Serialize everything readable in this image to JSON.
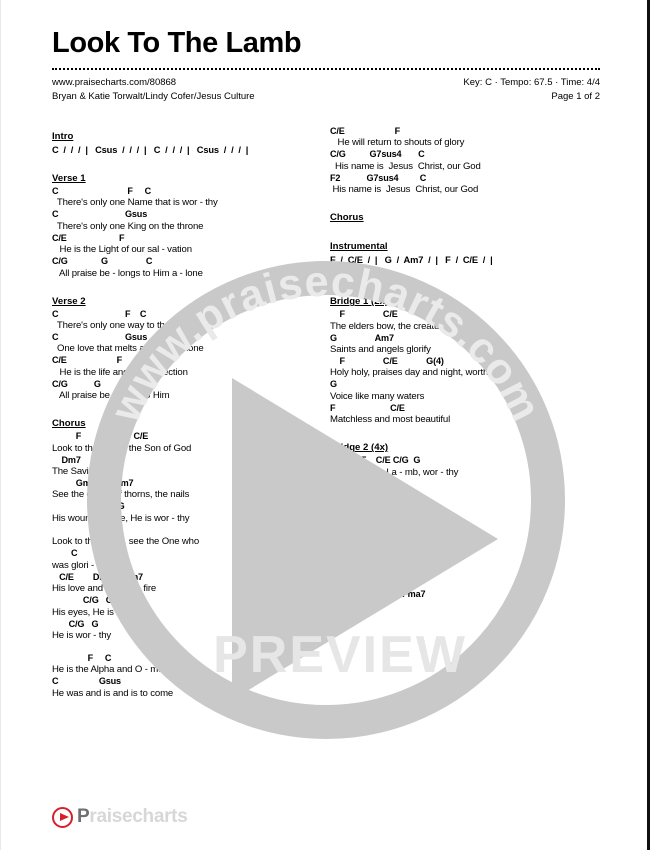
{
  "header": {
    "title": "Look To The Lamb",
    "url": "www.praisecharts.com/80868",
    "authors": "Bryan & Katie Torwalt/Lindy Cofer/Jesus Culture",
    "key_tempo_time": "Key: C · Tempo: 67.5 · Time: 4/4",
    "page_number": "Page 1 of 2"
  },
  "watermark": {
    "ring_text": "www.praisecharts.com",
    "preview_label": "PREVIEW",
    "ring_color": "#c9c9c9",
    "triangle_color": "#c9c9c9",
    "preview_color": "#e2e2e2"
  },
  "brand": {
    "name_visible": "P",
    "name_faded": "raisecharts",
    "accent_color": "#d6212b",
    "text_color": "#6f7072"
  },
  "left_column": [
    {
      "label": "Intro",
      "type": "progression",
      "lines": [
        "C  /  /  /  |   Csus  /  /  /  |   C  /  /  /  |   Csus  /  /  /  |"
      ]
    },
    {
      "label": "Verse 1",
      "type": "chords",
      "lines": [
        {
          "chords": "C                             F     C",
          "lyrics": "  There's only one Name that is wor - thy"
        },
        {
          "chords": "C                            Gsus",
          "lyrics": "  There's only one King on the throne"
        },
        {
          "chords": "C/E                      F",
          "lyrics": "   He is the Light of our sal - vation"
        },
        {
          "chords": "C/G              G                C",
          "lyrics": "   All praise be - longs to Him a - lone"
        }
      ]
    },
    {
      "label": "Verse 2",
      "type": "chords",
      "lines": [
        {
          "chords": "C                            F    C",
          "lyrics": "  There's only one way to the Fa - ther"
        },
        {
          "chords": "C                            Gsus",
          "lyrics": "  One love that melts a heart of stone"
        },
        {
          "chords": "C/E                     F",
          "lyrics": "   He is the life and resur - rection"
        },
        {
          "chords": "C/G           G",
          "lyrics": "   All praise be - longs to Him"
        }
      ]
    },
    {
      "label": "Chorus",
      "type": "chords",
      "lines": [
        {
          "chords": "          F                      C/E",
          "lyrics": "Look to the Lamb, the Son of God"
        },
        {
          "chords": "    Dm7",
          "lyrics": "The Savior"
        },
        {
          "chords": "          Gm7        Am7",
          "lyrics": "See the crown of thorns, the nails"
        },
        {
          "chords": "                  C/G   G",
          "lyrics": "His wounded side, He is wor - thy"
        },
        {
          "chords": "",
          "lyrics": "Look to the Lamb, see the One who"
        },
        {
          "chords": "        C       G",
          "lyrics": "was glori - fied"
        },
        {
          "chords": "   C/E        Dm7     Am7",
          "lyrics": "His love and there is   fire"
        },
        {
          "chords": "             C/G   G   /  C/E",
          "lyrics": "His eyes, He is wor - thy"
        },
        {
          "chords": "       C/G   G",
          "lyrics": "He is wor - thy"
        }
      ]
    },
    {
      "label": "",
      "type": "chords",
      "lines": [
        {
          "chords": "               F     C",
          "lyrics": "He is the Alpha and O - me - ga"
        },
        {
          "chords": "C                 Gsus",
          "lyrics": "He was and is and is to come"
        }
      ]
    }
  ],
  "right_column": [
    {
      "label": "",
      "type": "chords",
      "lines": [
        {
          "chords": "C/E                     F",
          "lyrics": "   He will return to shouts of glory"
        },
        {
          "chords": "C/G          G7sus4       C",
          "lyrics": "  His name is  Jesus  Christ, our God"
        },
        {
          "chords": "F2           G7sus4         C",
          "lyrics": " His name is  Jesus  Christ, our God"
        }
      ]
    },
    {
      "label": "Chorus",
      "type": "label-only",
      "lines": []
    },
    {
      "label": "Instrumental",
      "type": "progression",
      "lines": [
        "F  /  C/E  /  |   G  /  Am7  /  |   F  /  C/E  /  |",
        "G(4)  /  /  /  |"
      ]
    },
    {
      "label": "Bridge 1 (2x)",
      "type": "chords",
      "lines": [
        {
          "chords": "    F                C/E",
          "lyrics": "The elders bow, the creatures cry"
        },
        {
          "chords": "G                Am7",
          "lyrics": "Saints and angels glorify"
        },
        {
          "chords": "    F                C/E            G(4)",
          "lyrics": "Holy holy, praises day and night, worthy"
        },
        {
          "chords": "G",
          "lyrics": "Voice like many waters"
        },
        {
          "chords": "F                       C/E",
          "lyrics": "Matchless and most beautiful"
        }
      ]
    },
    {
      "label": "Bridge 2 (4x)",
      "type": "chords",
      "lines": [
        {
          "chords": "             F    C/E C/G  G",
          "lyrics": "Worthy is the La - mb, wor - thy"
        }
      ]
    },
    {
      "label": "Chorus",
      "type": "label-only",
      "lines": []
    },
    {
      "label": "",
      "type": "chords",
      "lines": [
        {
          "chords": "             C/E       C/G   G",
          "lyrics": "His wounded side is wor - thy"
        },
        {
          "chords": "                  C/G   G   C/G  G",
          "lyrics": "He is wor - thy, wor - thy"
        },
        {
          "chords": "                        Em7",
          "lyrics": ""
        },
        {
          "chords": "              G(4)  /  |   Fma7",
          "lyrics": ""
        }
      ]
    }
  ]
}
